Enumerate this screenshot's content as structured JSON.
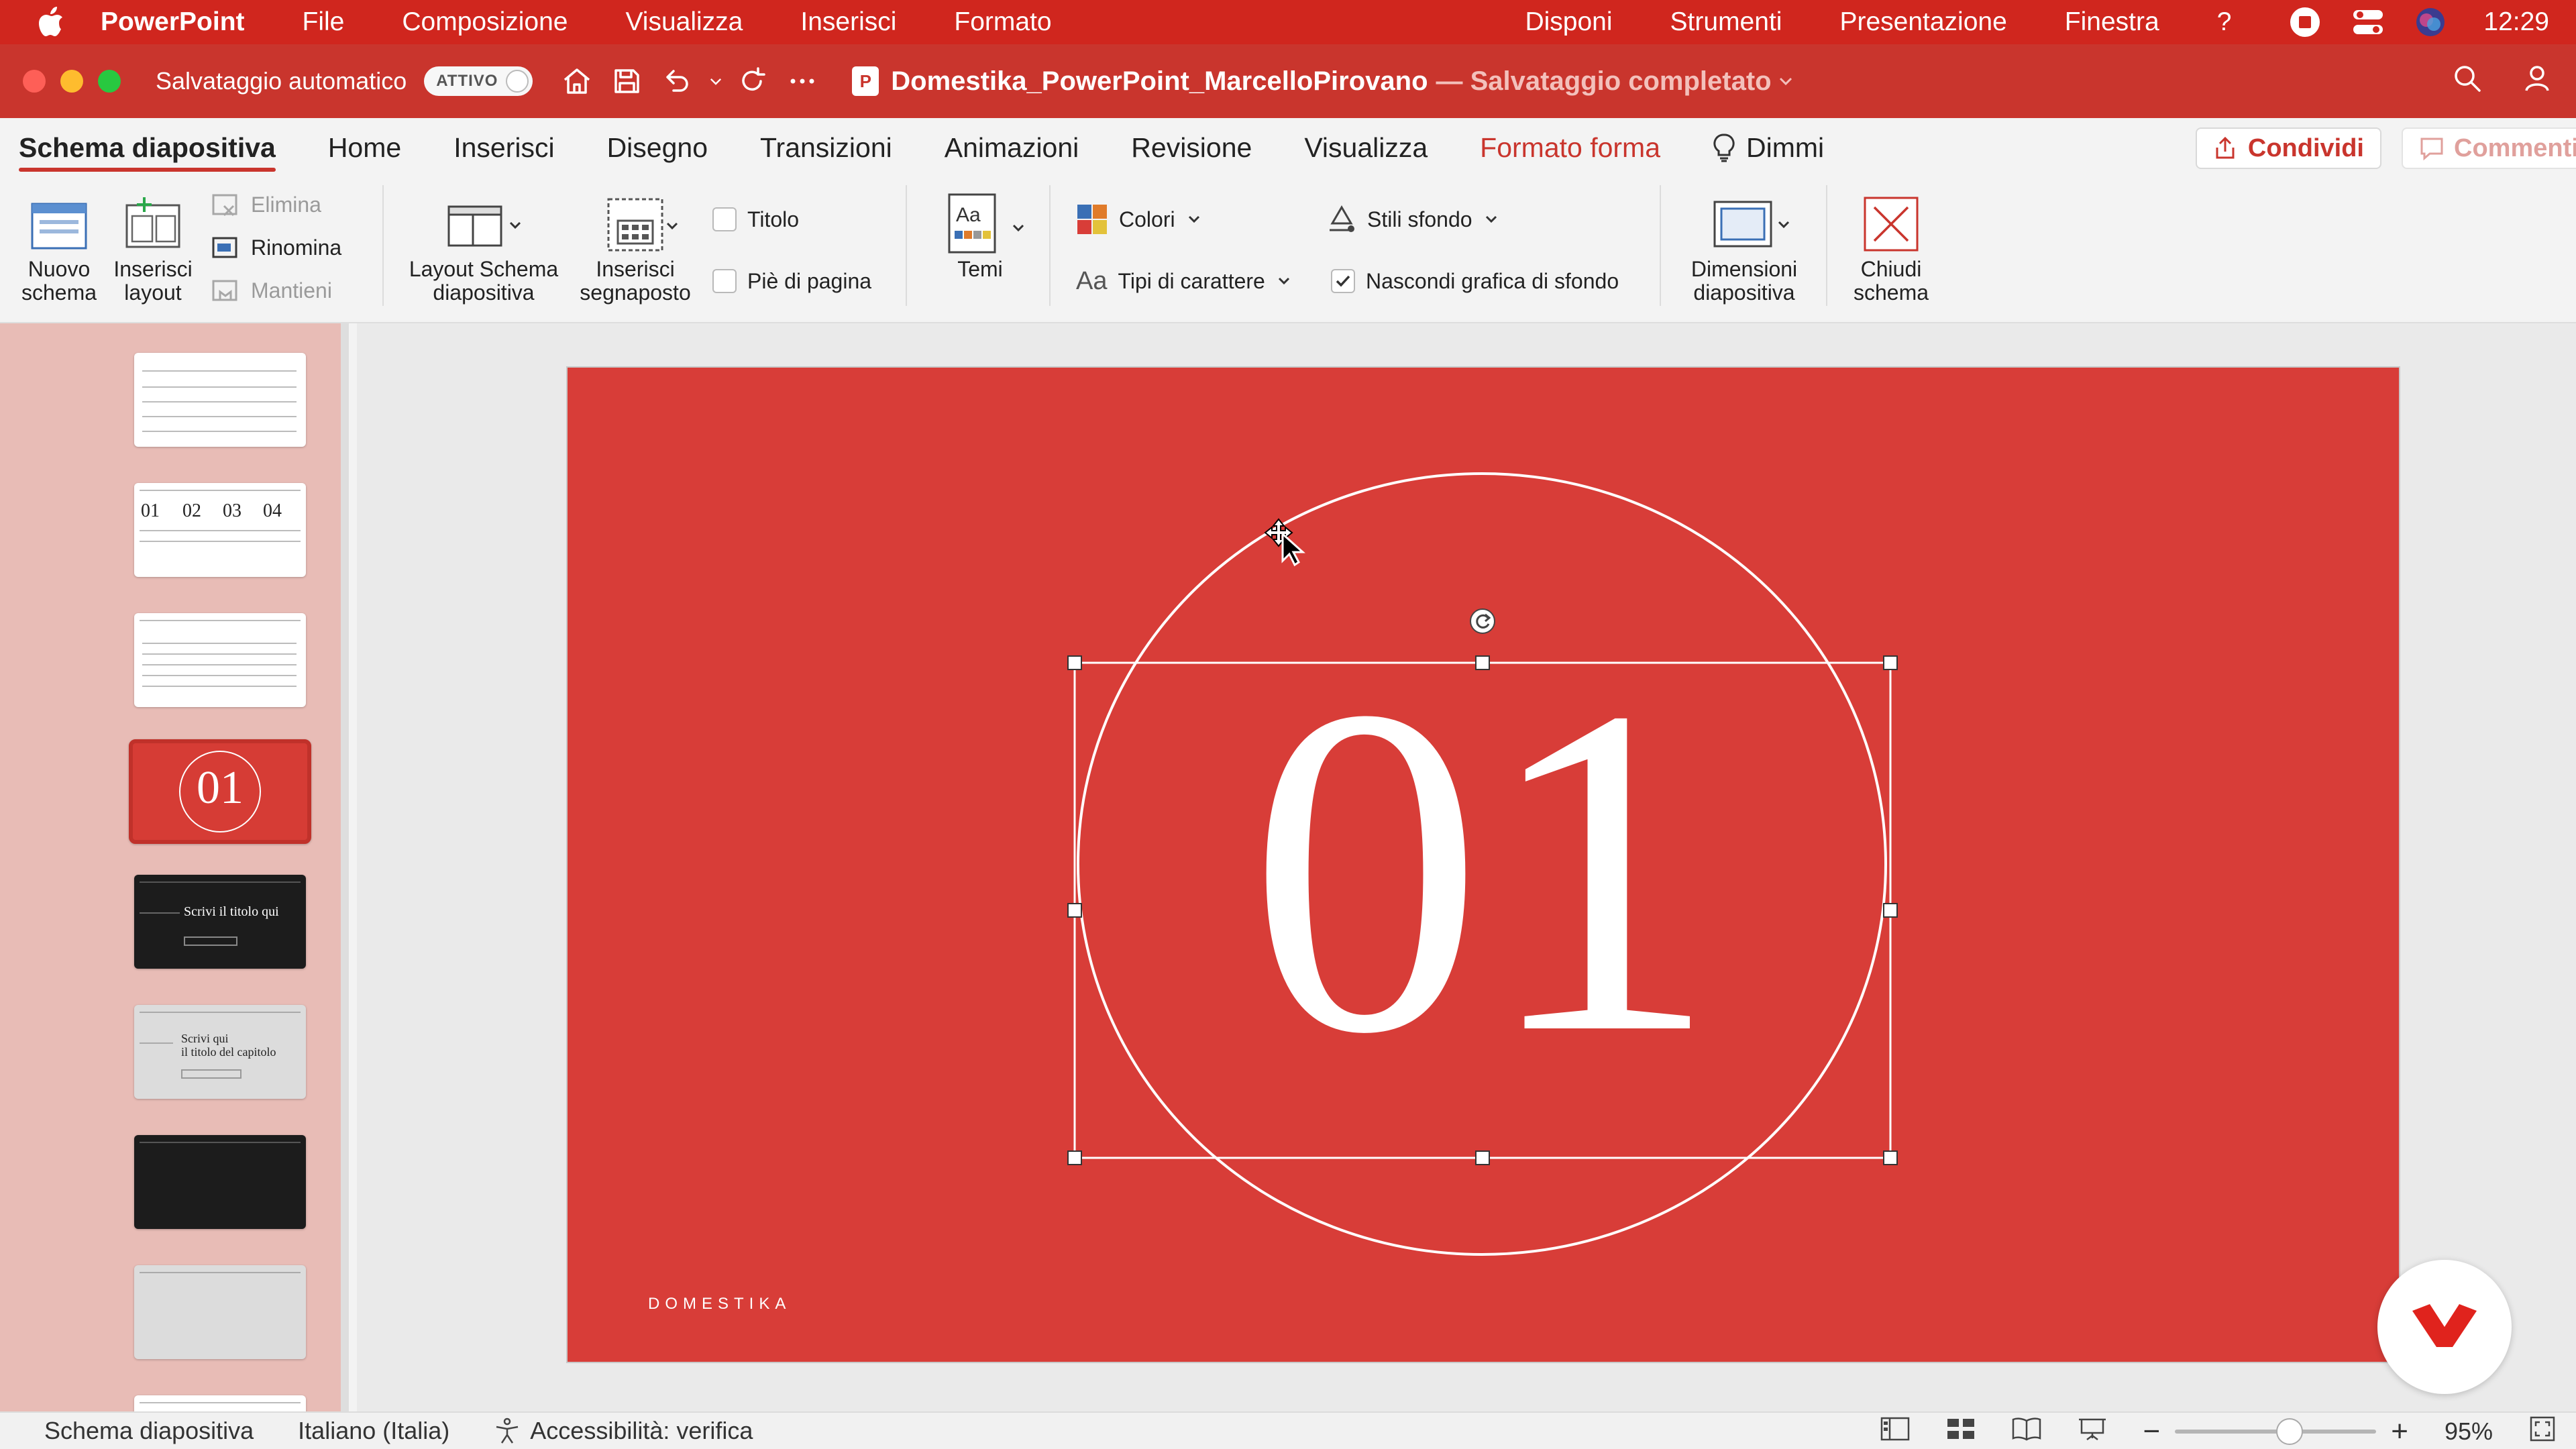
{
  "menubar": {
    "app_name": "PowerPoint",
    "items": [
      "File",
      "Composizione",
      "Visualizza",
      "Inserisci",
      "Formato"
    ],
    "right_items": [
      "Disponi",
      "Strumenti",
      "Presentazione",
      "Finestra",
      "?"
    ],
    "clock": "12:29",
    "background": "#d0261e"
  },
  "titlebar": {
    "autosave_label": "Salvataggio automatico",
    "autosave_state": "ATTIVO",
    "doc_name": "Domestika_PowerPoint_MarcelloPirovano",
    "doc_status": "— Salvataggio completato",
    "background": "#c9352d"
  },
  "tabs": {
    "items": [
      "Schema diapositiva",
      "Home",
      "Inserisci",
      "Disegno",
      "Transizioni",
      "Animazioni",
      "Revisione",
      "Visualizza",
      "Formato forma",
      "Dimmi"
    ],
    "share_label": "Condividi",
    "comments_label": "Commenti",
    "accent": "#c9352d"
  },
  "ribbon": {
    "new_master": "Nuovo\nschema",
    "new_master_l1": "Nuovo",
    "new_master_l2": "schema",
    "insert_layout_l1": "Inserisci",
    "insert_layout_l2": "layout",
    "delete": "Elimina",
    "rename": "Rinomina",
    "preserve": "Mantieni",
    "master_layout_l1": "Layout Schema",
    "master_layout_l2": "diapositiva",
    "insert_placeholder_l1": "Inserisci",
    "insert_placeholder_l2": "segnaposto",
    "title_chk": "Titolo",
    "footer_chk": "Piè di pagina",
    "themes": "Temi",
    "colors": "Colori",
    "fonts": "Tipi di carattere",
    "bg_styles": "Stili sfondo",
    "hide_bg": "Nascondi grafica di sfondo",
    "slide_size_l1": "Dimensioni",
    "slide_size_l2": "diapositiva",
    "close_l1": "Chiudi",
    "close_l2": "schema"
  },
  "sidebar": {
    "thumb_numbers": [
      "01",
      "02",
      "03",
      "04"
    ],
    "selected_label": "01",
    "dark_title": "Scrivi il titolo qui",
    "chapter_l1": "Scrivi qui",
    "chapter_l2": "il titolo del capitolo"
  },
  "slide": {
    "number": "01",
    "brand": "DOMESTIKA",
    "background": "#d83d38"
  },
  "statusbar": {
    "view": "Schema diapositiva",
    "language": "Italiano (Italia)",
    "accessibility": "Accessibilità: verifica",
    "zoom": "95%",
    "zoom_fraction": 0.95
  }
}
